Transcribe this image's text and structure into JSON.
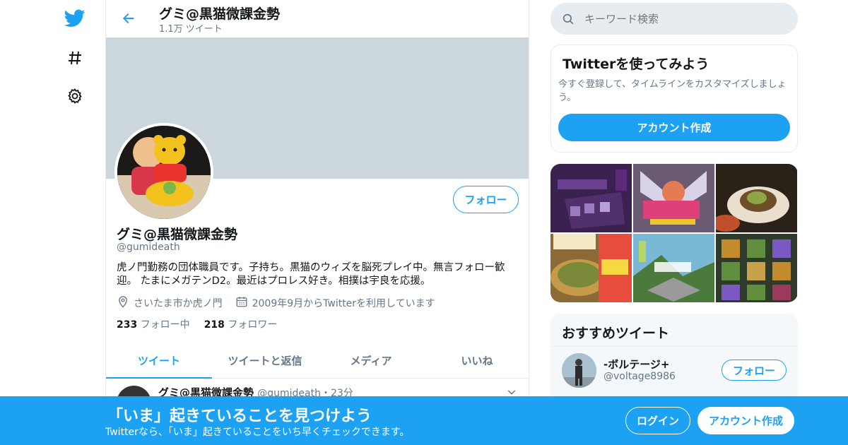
{
  "topbar": {
    "title": "グミ@黒猫微課金勢",
    "tweet_count": "1.1万 ツイート"
  },
  "profile": {
    "name": "グミ@黒猫微課金勢",
    "handle": "@gumideath",
    "bio": "虎ノ門勤務の団体職員です。子持ち。黒猫のウィズを脳死プレイ中。無言フォロー歓迎。 たまにメガテンD2。最近はプロレス好き。相撲は宇良を応援。",
    "location": "さいたま市か虎ノ門",
    "joined": "2009年9月からTwitterを利用しています",
    "following_count": "233",
    "following_label": "フォロー中",
    "followers_count": "218",
    "followers_label": "フォロワー",
    "follow_button": "フォロー"
  },
  "tabs": [
    "ツイート",
    "ツイートと返信",
    "メディア",
    "いいね"
  ],
  "tweet_preview": {
    "name": "グミ@黒猫微課金勢",
    "handle": "@gumideath",
    "time": "・23分"
  },
  "search": {
    "placeholder": "キーワード検索"
  },
  "signup_card": {
    "title": "Twitterを使ってみよう",
    "description": "今すぐ登録して、タイムラインをカスタマイズしましょう。",
    "button": "アカウント作成"
  },
  "recommended": {
    "title": "おすすめツイート",
    "user_name": "-ボルテージ+",
    "user_handle": "@voltage8986",
    "follow_button": "フォロー"
  },
  "bottom_bar": {
    "title": "「いま」起きていることを見つけよう",
    "subtitle": "Twitterなら、「いま」起きていることをいち早くチェックできます。",
    "login": "ログイン",
    "signup": "アカウント作成"
  },
  "colors": {
    "accent": "#1da1f2",
    "banner": "#ccd6dd",
    "muted": "#657786"
  },
  "icons": [
    "twitter-bird-icon",
    "hashtag-icon",
    "gear-icon",
    "back-arrow-icon",
    "location-icon",
    "calendar-icon",
    "search-icon",
    "chevron-down-icon"
  ]
}
